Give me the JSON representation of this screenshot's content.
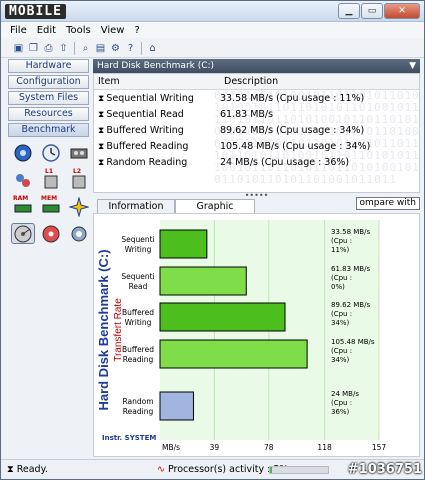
{
  "app": {
    "logo_text": "MOBILE",
    "window_buttons": [
      "▁",
      "▭",
      "✕"
    ]
  },
  "menu": [
    "File",
    "Edit",
    "Tools",
    "View",
    "?"
  ],
  "toolbar_icons": [
    "save-icon",
    "copy-icon",
    "print-icon",
    "export-icon",
    "search-icon",
    "folder-icon",
    "options-icon",
    "help-icon",
    "home-icon"
  ],
  "nav": {
    "items": [
      "Hardware",
      "Configuration",
      "System Files",
      "Resources",
      "Benchmark"
    ],
    "active": "Benchmark"
  },
  "tool_icons": [
    {
      "name": "cpu-benchmark-icon",
      "label": ""
    },
    {
      "name": "clock-benchmark-icon",
      "label": ""
    },
    {
      "name": "gpu-benchmark-icon",
      "label": ""
    },
    {
      "name": "cache-benchmark-icon",
      "label": "L1"
    },
    {
      "name": "l1-cache-icon",
      "label": "L1"
    },
    {
      "name": "l2-cache-icon",
      "label": "L2"
    },
    {
      "name": "ram-benchmark-icon",
      "label": "RAM"
    },
    {
      "name": "memory-benchmark-icon",
      "label": "MEM"
    },
    {
      "name": "display-benchmark-icon",
      "label": ""
    },
    {
      "name": "hard-disk-icon",
      "label": ""
    },
    {
      "name": "cdrom-icon",
      "label": ""
    },
    {
      "name": "network-icon",
      "label": ""
    }
  ],
  "panel": {
    "title": "Hard Disk Benchmark (C:)",
    "col_item": "Item",
    "col_desc": "Description",
    "rows": [
      {
        "item": "Sequential Writing",
        "desc": "33.58 MB/s  (Cpu usage : 11%)"
      },
      {
        "item": "Sequential Read",
        "desc": "61.83 MB/s"
      },
      {
        "item": "Buffered Writing",
        "desc": "89.62 MB/s  (Cpu usage : 34%)"
      },
      {
        "item": "Buffered Reading",
        "desc": "105.48 MB/s  (Cpu usage : 34%)"
      },
      {
        "item": "Random Reading",
        "desc": "24 MB/s  (Cpu usage : 36%)"
      }
    ]
  },
  "tabs": [
    "Information",
    "Graphic"
  ],
  "active_tab": "Graphic",
  "compare_label": "ompare with",
  "chart_data": {
    "type": "bar",
    "title": "Hard Disk Benchmark (C:)",
    "subtitle": "Transfert Rate",
    "categories": [
      "Sequenti Writing",
      "Sequenti Read",
      "Buffered Writing",
      "Buffered Reading",
      "Random Reading"
    ],
    "values": [
      33.58,
      61.83,
      89.62,
      105.48,
      24
    ],
    "value_labels": [
      "33.58 MB/s (Cpu : 11%)",
      "61.83 MB/s (Cpu : 0%)",
      "89.62 MB/s (Cpu : 34%)",
      "105.48 MB/s (Cpu : 34%)",
      "24 MB/s (Cpu : 36%)"
    ],
    "bar_colors": [
      "#4cbf1f",
      "#7fdd4a",
      "#4cbf1f",
      "#7fdd4a",
      "#a2b4e0"
    ],
    "unit": "MB/s",
    "x_ticks": [
      "39",
      "78",
      "118",
      "157"
    ],
    "xlim": [
      0,
      157
    ],
    "grid": true,
    "brand": "Instr. SYSTEM"
  },
  "status": {
    "ready": "Ready.",
    "activity": "Processor(s) activity : 3%",
    "activity_value": 3,
    "watermark": "#1036751"
  }
}
